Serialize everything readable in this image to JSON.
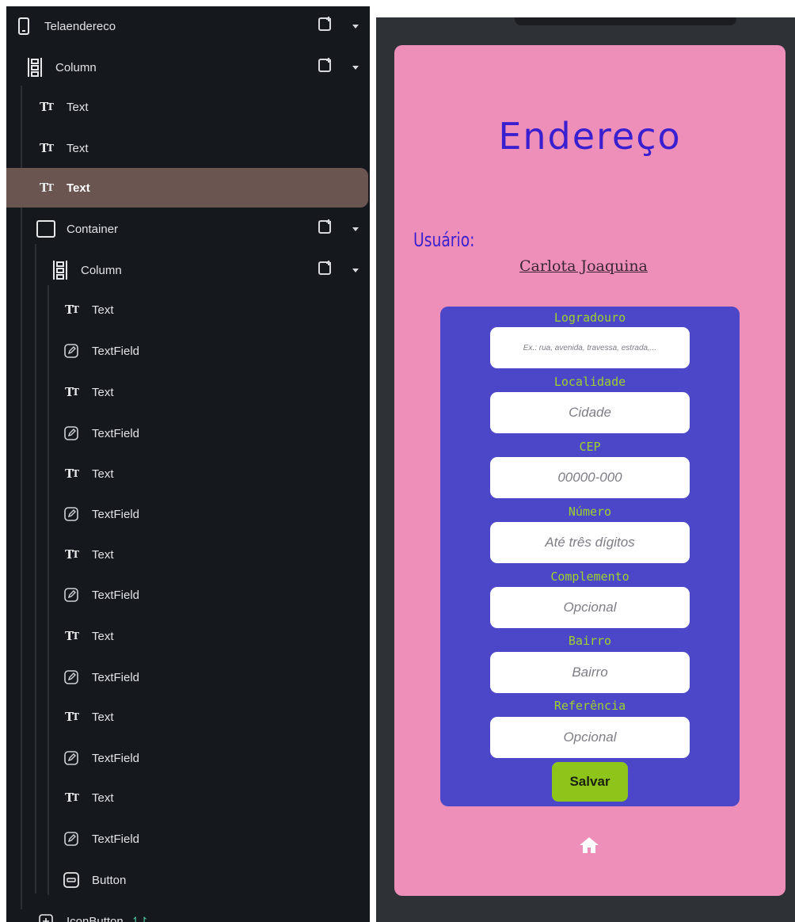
{
  "tree": {
    "items": [
      {
        "type": "phone",
        "label": "Telaendereco"
      },
      {
        "type": "column",
        "label": "Column"
      },
      {
        "type": "text",
        "label": "Text"
      },
      {
        "type": "text",
        "label": "Text"
      },
      {
        "type": "text",
        "label": "Text",
        "selected": true
      },
      {
        "type": "container",
        "label": "Container"
      },
      {
        "type": "column",
        "label": "Column"
      },
      {
        "type": "text",
        "label": "Text"
      },
      {
        "type": "textfield",
        "label": "TextField"
      },
      {
        "type": "text",
        "label": "Text"
      },
      {
        "type": "textfield",
        "label": "TextField"
      },
      {
        "type": "text",
        "label": "Text"
      },
      {
        "type": "textfield",
        "label": "TextField"
      },
      {
        "type": "text",
        "label": "Text"
      },
      {
        "type": "textfield",
        "label": "TextField"
      },
      {
        "type": "text",
        "label": "Text"
      },
      {
        "type": "textfield",
        "label": "TextField"
      },
      {
        "type": "text",
        "label": "Text"
      },
      {
        "type": "textfield",
        "label": "TextField"
      },
      {
        "type": "text",
        "label": "Text"
      },
      {
        "type": "textfield",
        "label": "TextField"
      },
      {
        "type": "button",
        "label": "Button"
      },
      {
        "type": "iconbutton",
        "label": "IconButton"
      }
    ]
  },
  "app": {
    "title": "Endereço",
    "user_label": "Usuário:",
    "user_name": "Carlota Joaquina",
    "fields": [
      {
        "label": "Logradouro",
        "placeholder": "Ex.: rua, avenida, travessa, estrada,..."
      },
      {
        "label": "Localidade",
        "placeholder": "Cidade"
      },
      {
        "label": "CEP",
        "placeholder": "00000-000"
      },
      {
        "label": "Número",
        "placeholder": "Até três dígitos"
      },
      {
        "label": "Complemento",
        "placeholder": "Opcional"
      },
      {
        "label": "Bairro",
        "placeholder": "Bairro"
      },
      {
        "label": "Referência",
        "placeholder": "Opcional"
      }
    ],
    "save_label": "Salvar"
  },
  "colors": {
    "screen_bg": "#ee8fba",
    "card_bg": "#4b47c8",
    "title": "#3a1fd0",
    "field_label": "#9fd22b",
    "button_bg": "#8fc41b",
    "selected_row": "#6b5550"
  }
}
